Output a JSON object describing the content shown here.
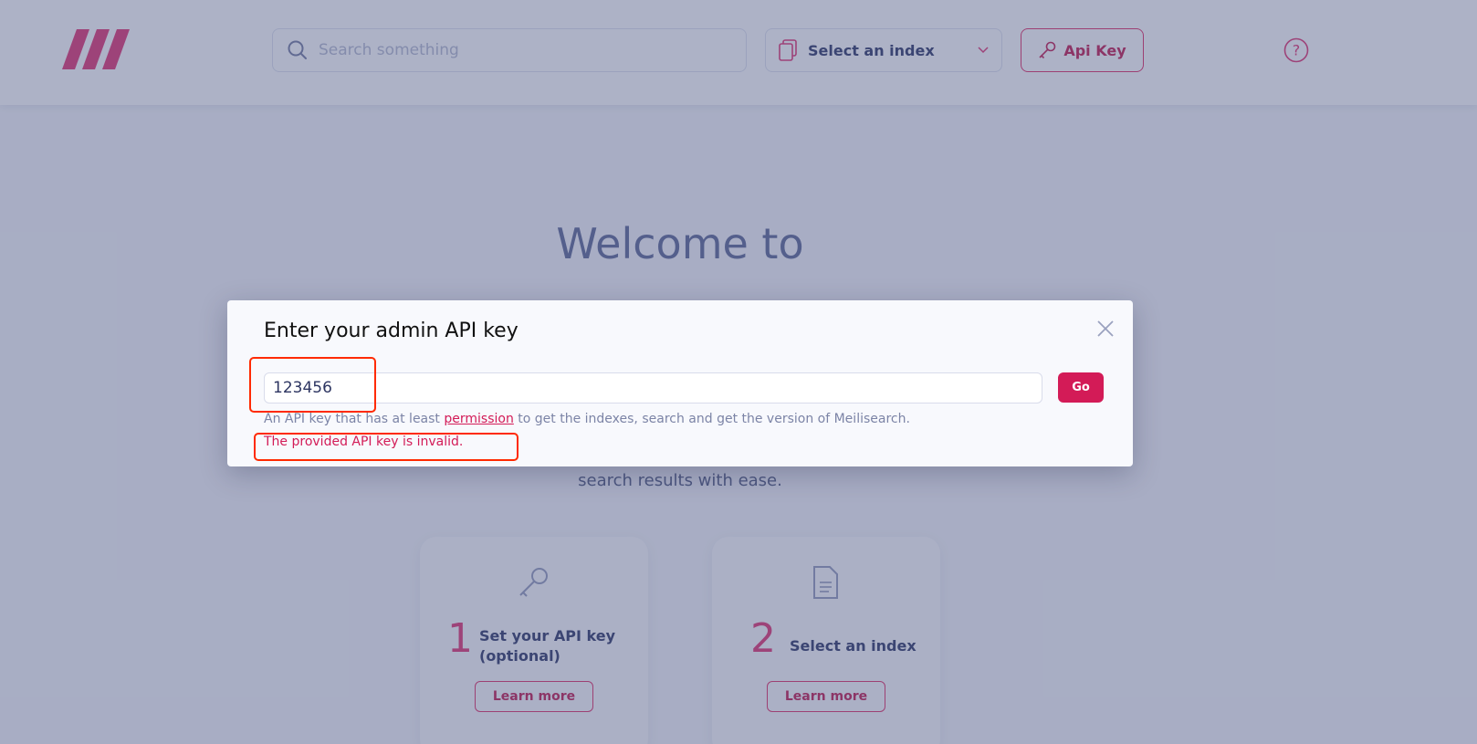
{
  "header": {
    "search_placeholder": "Search something",
    "index_select_label": "Select an index",
    "api_key_button": "Api Key"
  },
  "welcome": {
    "title": "Welcome to",
    "subtitle_line": "search results with ease."
  },
  "steps": [
    {
      "number": "1",
      "label_line1": "Set your API key",
      "label_line2": "(optional)",
      "button": "Learn more"
    },
    {
      "number": "2",
      "label_line1": "Select an index",
      "button": "Learn more"
    }
  ],
  "modal": {
    "title": "Enter your admin API key",
    "input_value": "123456",
    "go_button": "Go",
    "hint_before": "An API key that has at least ",
    "hint_link": "permission",
    "hint_after": " to get the indexes, search and get the version of Meilisearch.",
    "error": "The provided API key is invalid."
  },
  "colors": {
    "brand": "#d31b57",
    "overlay": "rgba(60,72,120,0.42)",
    "annotation": "#ff2a00"
  }
}
